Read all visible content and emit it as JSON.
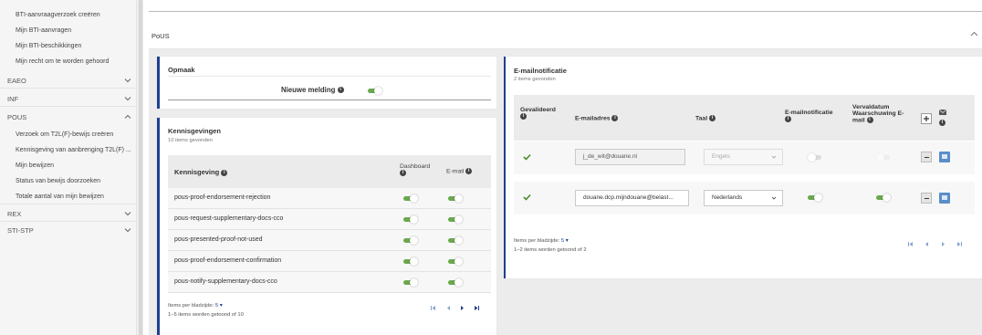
{
  "sidebar": {
    "items": [
      {
        "label": "BTI-aanvraagverzoek creëren"
      },
      {
        "label": "Mijn BTI-aanvragen"
      },
      {
        "label": "Mijn BTI-beschikkingen"
      },
      {
        "label": "Mijn recht om te worden gehoord"
      },
      {
        "label": "EAEO"
      },
      {
        "label": "INF"
      },
      {
        "label": "POUS"
      },
      {
        "label": "Verzoek om T2L(F)-bewijs creëren"
      },
      {
        "label": "Kennisgeving van aanbrenging T2L(F) ..."
      },
      {
        "label": "Mijn bewijzen"
      },
      {
        "label": "Status van bewijs doorzoeken"
      },
      {
        "label": "Totale aantal van mijn bewijzen"
      },
      {
        "label": "REX"
      },
      {
        "label": "STI-STP"
      }
    ]
  },
  "section": {
    "title": "PoUS"
  },
  "opmaak": {
    "title": "Opmaak",
    "new_message_label": "Nieuwe melding",
    "new_message_enabled": true
  },
  "kennisgevingen": {
    "title": "Kennisgevingen",
    "count_text": "10 items gevonden",
    "headers": {
      "name": "Kennisgeving",
      "dashboard": "Dashboard",
      "email": "E-mail"
    },
    "rows": [
      {
        "name": "pous-proof-endorsement-rejection",
        "dashboard": true,
        "email": true
      },
      {
        "name": "pous-request-supplementary-docs-cco",
        "dashboard": true,
        "email": true
      },
      {
        "name": "pous-presented-proof-not-used",
        "dashboard": true,
        "email": true
      },
      {
        "name": "pous-proof-endorsement-confirmation",
        "dashboard": true,
        "email": true
      },
      {
        "name": "pous-notify-supplementary-docs-cco",
        "dashboard": true,
        "email": true
      }
    ],
    "per_page_label": "Items per bladzijde:",
    "per_page_value": "5",
    "range_text": "1–5 items worden getoond of 10"
  },
  "emailnotificatie": {
    "title": "E-mailnotificatie",
    "count_text": "2 items gevonden",
    "headers": {
      "validated": "Gevalideerd",
      "address": "E-mailadres",
      "language": "Taal",
      "notification": "E-mailnotificatie",
      "expiry": "Vervaldatum Waarschuwing E-mail"
    },
    "rows": [
      {
        "validated": true,
        "address": "j_de_wit@douane.nl",
        "language": "Engels",
        "notification": false,
        "expiry": false,
        "readonly": true
      },
      {
        "validated": true,
        "address": "douane.dcp.mijndouane@belast...",
        "language": "Nederlands",
        "notification": true,
        "expiry": true,
        "readonly": false
      }
    ],
    "per_page_label": "Items per bladzijde:",
    "per_page_value": "5",
    "range_text": "1–2 items worden getoond of 2"
  },
  "colors": {
    "accent_blue": "#1f3f8f",
    "toggle_green": "#6aa84f",
    "check_green": "#4c8a2a",
    "action_blue": "#5b8ec7"
  },
  "icons": {
    "info": "info-circle-icon",
    "expand": "chevron-down-icon",
    "collapse": "chevron-up-icon",
    "check": "check-icon",
    "mail": "envelope-icon",
    "add": "plus-icon",
    "remove": "minus-icon",
    "save": "save-icon",
    "page_first": "page-first-icon",
    "page_prev": "page-prev-icon",
    "page_next": "page-next-icon",
    "page_last": "page-last-icon",
    "select": "caret-down-icon"
  }
}
